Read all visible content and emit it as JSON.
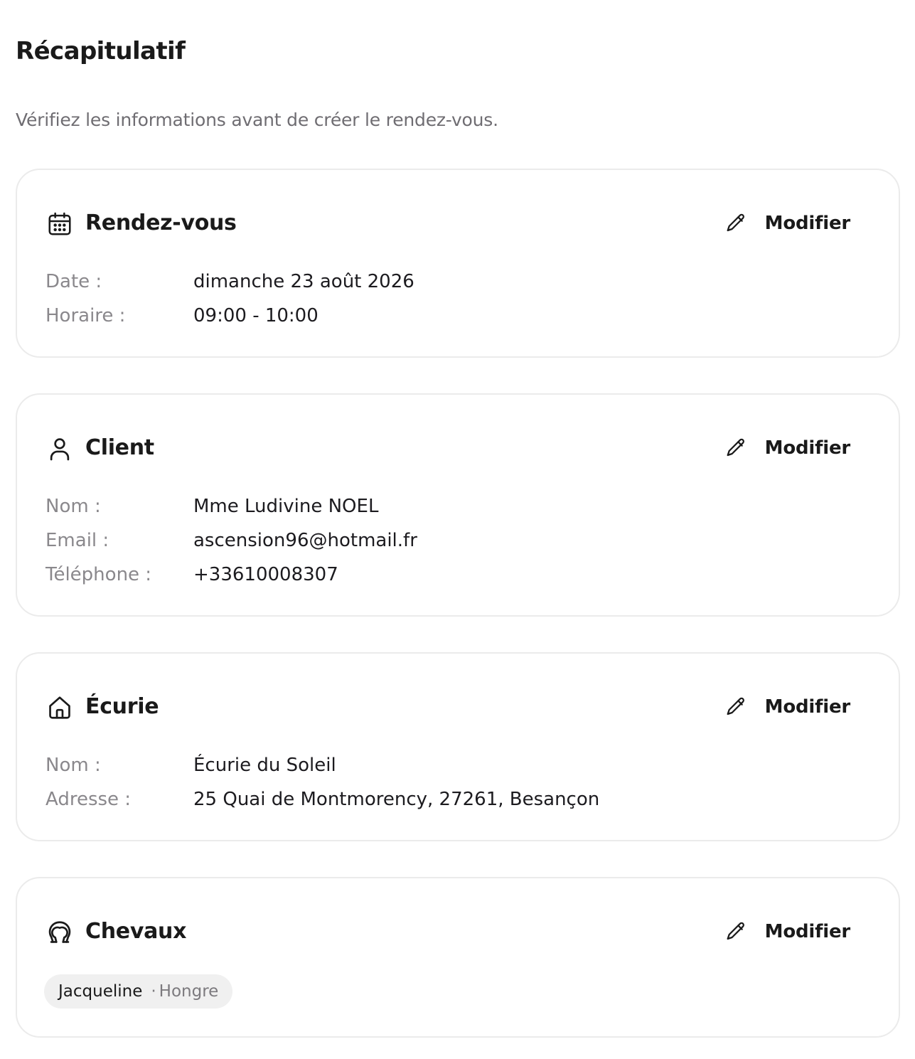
{
  "page": {
    "title": "Récapitulatif",
    "subtitle": "Vérifiez les informations avant de créer le rendez-vous."
  },
  "colors": {
    "text_primary": "#1a1a1a",
    "text_muted": "#8a888c",
    "card_border": "#ebebeb",
    "chip_background": "#f0f0f0"
  },
  "cards": {
    "appointment": {
      "icon": "calendar-icon",
      "title": "Rendez-vous",
      "edit_label": "Modifier",
      "fields": [
        {
          "label": "Date :",
          "value": "dimanche 23 août 2026"
        },
        {
          "label": "Horaire :",
          "value": "09:00 - 10:00"
        }
      ]
    },
    "client": {
      "icon": "user-icon",
      "title": "Client",
      "edit_label": "Modifier",
      "fields": [
        {
          "label": "Nom :",
          "value": "Mme Ludivine NOEL"
        },
        {
          "label": "Email :",
          "value": "ascension96@hotmail.fr"
        },
        {
          "label": "Téléphone :",
          "value": "+33610008307"
        }
      ]
    },
    "stable": {
      "icon": "home-icon",
      "title": "Écurie",
      "edit_label": "Modifier",
      "fields": [
        {
          "label": "Nom :",
          "value": "Écurie du Soleil"
        },
        {
          "label": "Adresse :",
          "value": "25 Quai de Montmorency, 27261, Besançon"
        }
      ]
    },
    "horses": {
      "icon": "horseshoe-icon",
      "title": "Chevaux",
      "edit_label": "Modifier",
      "items": [
        {
          "name": "Jacqueline",
          "separator": "·",
          "type": "Hongre"
        }
      ]
    }
  }
}
